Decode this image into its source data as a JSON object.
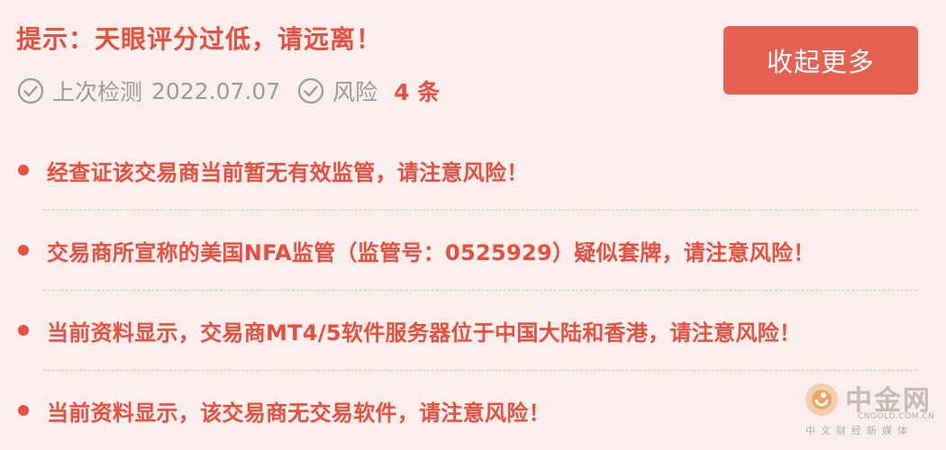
{
  "header": {
    "title": "提示：天眼评分过低，请远离！",
    "collapse_label": "收起更多"
  },
  "meta": {
    "check_icon": "check-circle-icon",
    "last_check_label": "上次检测",
    "last_check_date": "2022.07.07",
    "risk_label": "风险",
    "risk_count": "4 条"
  },
  "risks": [
    "经查证该交易商当前暂无有效监管，请注意风险！",
    "交易商所宣称的美国NFA监管（监管号：0525929）疑似套牌，请注意风险！",
    "当前资料显示，交易商MT4/5软件服务器位于中国大陆和香港，请注意风险！",
    "当前资料显示，该交易商无交易软件，请注意风险！"
  ],
  "watermark": {
    "name": "中金网",
    "domain": "CNGOLD.COM.CN",
    "slogan": "中文财经新媒体"
  },
  "colors": {
    "accent": "#e84f3d",
    "button": "#e86150",
    "background": "#fdeeee",
    "muted": "#9a9a9a"
  }
}
